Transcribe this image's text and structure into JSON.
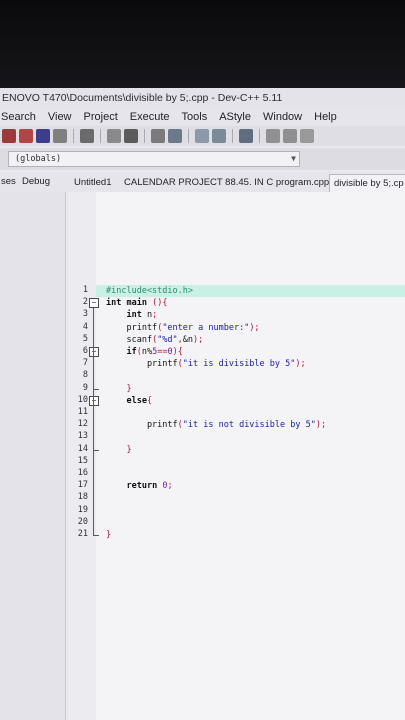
{
  "window": {
    "title": "ENOVO T470\\Documents\\divisible by 5;.cpp - Dev-C++ 5.11"
  },
  "menu": [
    "Search",
    "View",
    "Project",
    "Execute",
    "Tools",
    "AStyle",
    "Window",
    "Help"
  ],
  "scope": {
    "value": "(globals)"
  },
  "left_tabs": [
    "ses",
    "Debug"
  ],
  "file_tabs": [
    {
      "label": "Untitled1",
      "active": false
    },
    {
      "label": "CALENDAR PROJECT 88.45. IN C program.cpp",
      "active": false
    },
    {
      "label": "divisible by 5;.cp",
      "active": true
    }
  ],
  "editor": {
    "highlight_line": 1,
    "lines": [
      {
        "n": "1",
        "tokens": [
          [
            "pp",
            "#include<stdio.h>"
          ]
        ]
      },
      {
        "n": "2",
        "tokens": [
          [
            "kw",
            "int"
          ],
          [
            "txt",
            " "
          ],
          [
            "kw",
            "main"
          ],
          [
            "txt",
            " "
          ],
          [
            "sym",
            "(){"
          ]
        ]
      },
      {
        "n": "3",
        "tokens": [
          [
            "txt",
            "    "
          ],
          [
            "kw",
            "int"
          ],
          [
            "txt",
            " n"
          ],
          [
            "sym",
            ";"
          ]
        ]
      },
      {
        "n": "4",
        "tokens": [
          [
            "txt",
            "    printf"
          ],
          [
            "sym",
            "("
          ],
          [
            "str",
            "\"enter a number:\""
          ],
          [
            "sym",
            ");"
          ]
        ]
      },
      {
        "n": "5",
        "tokens": [
          [
            "txt",
            "    scanf"
          ],
          [
            "sym",
            "("
          ],
          [
            "str",
            "\"%d\""
          ],
          [
            "sym",
            ","
          ],
          [
            "txt",
            "&n"
          ],
          [
            "sym",
            ");"
          ]
        ]
      },
      {
        "n": "6",
        "tokens": [
          [
            "txt",
            "    "
          ],
          [
            "kw",
            "if"
          ],
          [
            "sym",
            "("
          ],
          [
            "txt",
            "n%"
          ],
          [
            "num",
            "5"
          ],
          [
            "sym",
            "=="
          ],
          [
            "num",
            "0"
          ],
          [
            "sym",
            "){"
          ]
        ]
      },
      {
        "n": "7",
        "tokens": [
          [
            "txt",
            "        printf"
          ],
          [
            "sym",
            "("
          ],
          [
            "str",
            "\"it is divisible by 5\""
          ],
          [
            "sym",
            ");"
          ]
        ]
      },
      {
        "n": "8",
        "tokens": []
      },
      {
        "n": "9",
        "tokens": [
          [
            "txt",
            "    "
          ],
          [
            "sym",
            "}"
          ]
        ]
      },
      {
        "n": "10",
        "tokens": [
          [
            "txt",
            "    "
          ],
          [
            "kw",
            "else"
          ],
          [
            "sym",
            "{"
          ]
        ]
      },
      {
        "n": "11",
        "tokens": []
      },
      {
        "n": "12",
        "tokens": [
          [
            "txt",
            "        printf"
          ],
          [
            "sym",
            "("
          ],
          [
            "str",
            "\"it is not divisible by 5\""
          ],
          [
            "sym",
            ");"
          ]
        ]
      },
      {
        "n": "13",
        "tokens": []
      },
      {
        "n": "14",
        "tokens": [
          [
            "txt",
            "    "
          ],
          [
            "sym",
            "}"
          ]
        ]
      },
      {
        "n": "15",
        "tokens": []
      },
      {
        "n": "16",
        "tokens": []
      },
      {
        "n": "17",
        "tokens": [
          [
            "txt",
            "    "
          ],
          [
            "kw",
            "return"
          ],
          [
            "txt",
            " "
          ],
          [
            "num",
            "0"
          ],
          [
            "sym",
            ";"
          ]
        ]
      },
      {
        "n": "18",
        "tokens": []
      },
      {
        "n": "19",
        "tokens": []
      },
      {
        "n": "20",
        "tokens": []
      },
      {
        "n": "21",
        "tokens": [
          [
            "sym",
            "}"
          ]
        ]
      }
    ],
    "fold_markers": [
      "2",
      "6",
      "10"
    ]
  },
  "toolbar_icon_colors": [
    "#9a3b3b",
    "#b04646",
    "#3d3d8a",
    "#808080",
    "#6a6a6a",
    "#8a8a8a",
    "#5a5a5a",
    "#7a7a7a",
    "#6a7a8a",
    "#8a9aaa",
    "#7a8a99",
    "#5f6f7f",
    "#909090",
    "#8f8f8f",
    "#999999"
  ]
}
